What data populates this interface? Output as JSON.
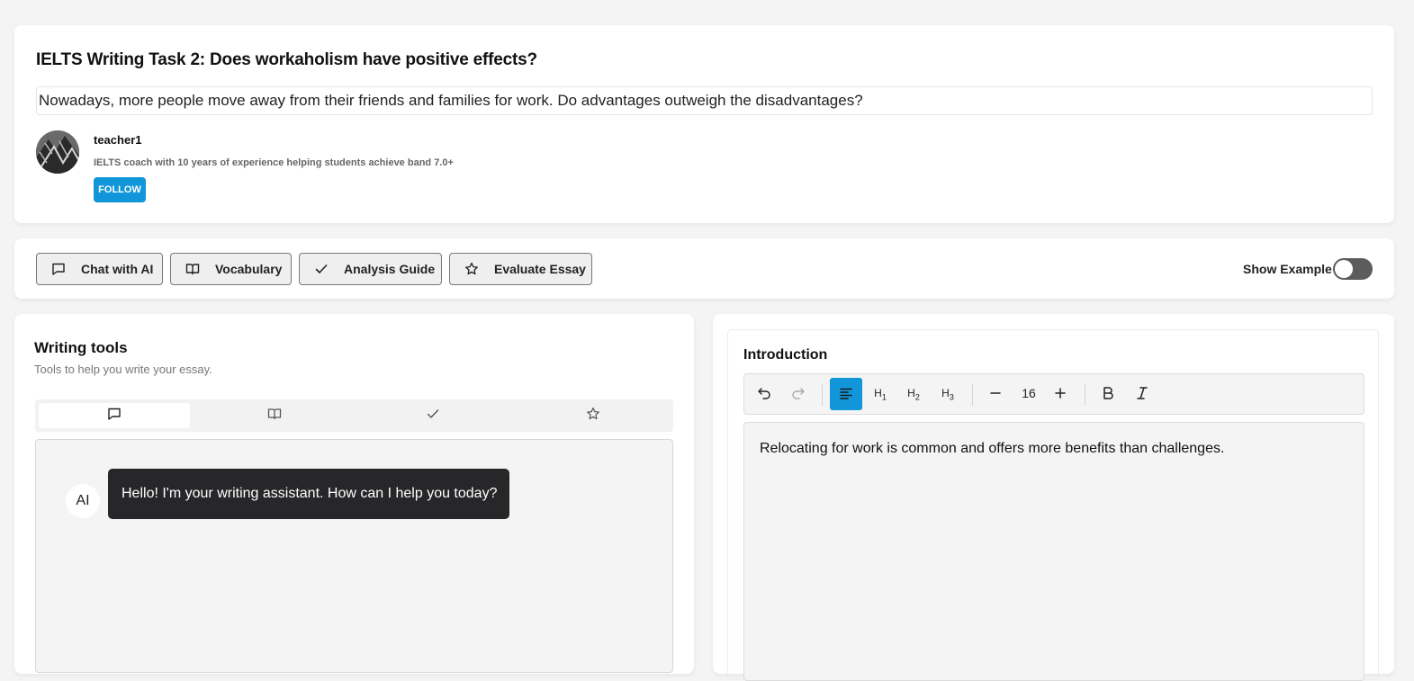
{
  "task": {
    "title": "IELTS Writing Task 2: Does workaholism have positive effects?",
    "prompt": "Nowadays, more people move away from their friends and families for work. Do advantages outweigh the disadvantages?"
  },
  "author": {
    "name": "teacher1",
    "bio": "IELTS coach with 10 years of experience helping students achieve band 7.0+",
    "follow_label": "FOLLOW"
  },
  "toolbar": {
    "buttons": [
      {
        "label": "Chat with AI",
        "icon": "chat-bubble-icon"
      },
      {
        "label": "Vocabulary",
        "icon": "book-open-icon"
      },
      {
        "label": "Analysis Guide",
        "icon": "check-icon"
      },
      {
        "label": "Evaluate Essay",
        "icon": "star-icon"
      }
    ],
    "show_example_label": "Show Example",
    "show_example_on": false
  },
  "writing_tools": {
    "title": "Writing tools",
    "subtitle": "Tools to help you write your essay.",
    "tabs": [
      {
        "icon": "chat-bubble-icon",
        "active": true
      },
      {
        "icon": "book-open-icon",
        "active": false
      },
      {
        "icon": "check-icon",
        "active": false
      },
      {
        "icon": "star-icon",
        "active": false
      }
    ],
    "chat": {
      "avatar_label": "AI",
      "message": "Hello! I'm your writing assistant. How can I help you today?"
    }
  },
  "editor": {
    "section_label": "Introduction",
    "font_size": "16",
    "content": "Relocating for work is common and offers more benefits than challenges.",
    "accent_color": "#1196d9"
  }
}
